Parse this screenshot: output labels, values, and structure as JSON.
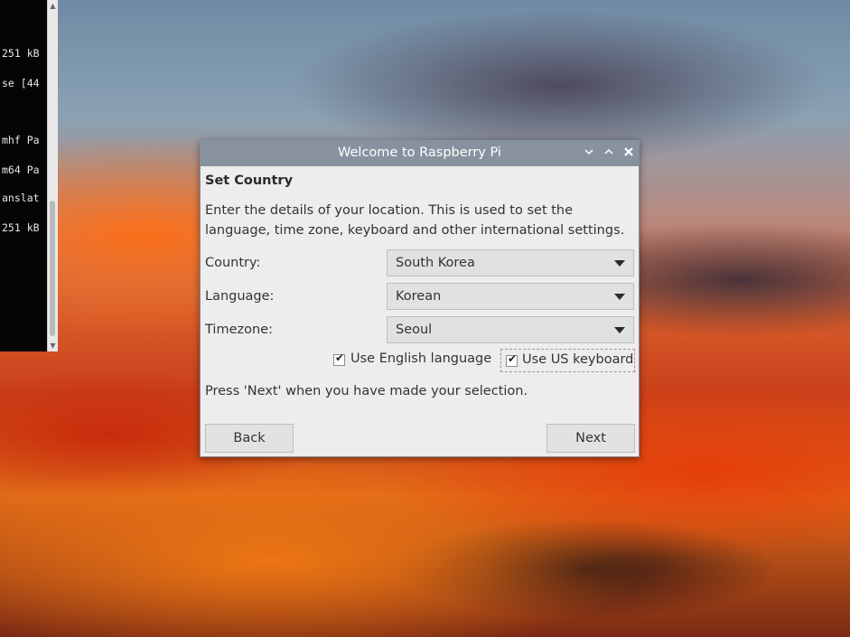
{
  "terminal": {
    "lines": [
      "251 kB",
      "se [44",
      "",
      "mhf Pa",
      "m64 Pa",
      "anslat",
      "251 kB"
    ]
  },
  "dialog": {
    "title": "Welcome to Raspberry Pi",
    "titlebar_icons": [
      "chevron-down-icon",
      "chevron-up-icon",
      "close-icon"
    ],
    "heading": "Set Country",
    "description": "Enter the details of your location. This is used to set the language, time zone, keyboard and other international settings.",
    "fields": {
      "country": {
        "label": "Country:",
        "value": "South Korea"
      },
      "language": {
        "label": "Language:",
        "value": "Korean"
      },
      "timezone": {
        "label": "Timezone:",
        "value": "Seoul"
      }
    },
    "checkboxes": {
      "english": {
        "label": "Use English language",
        "checked": true
      },
      "us_keyboard": {
        "label": "Use US keyboard",
        "checked": true
      }
    },
    "footer_text": "Press 'Next' when you have made your selection.",
    "buttons": {
      "back": "Back",
      "next": "Next"
    }
  }
}
